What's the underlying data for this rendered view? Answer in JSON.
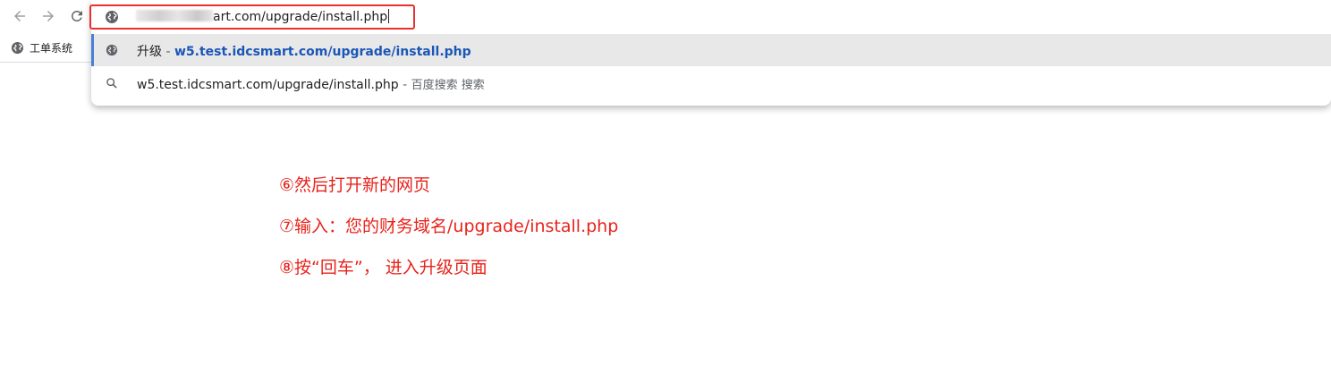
{
  "toolbar": {
    "back_icon": "arrow-left-icon",
    "forward_icon": "arrow-right-icon",
    "reload_icon": "reload-icon"
  },
  "bookmarks": {
    "items": [
      {
        "label": "工单系统",
        "icon": "globe-icon"
      }
    ]
  },
  "address_bar": {
    "value_visible": "art.com/upgrade/install.php",
    "icon": "globe-icon",
    "highlight_color": "#e8312c"
  },
  "suggestions": [
    {
      "icon": "globe-icon",
      "title": "升级",
      "separator": " - ",
      "url": "w5.test.idcsmart.com/upgrade/install.php",
      "selected": true
    },
    {
      "icon": "search-icon",
      "query": "w5.test.idcsmart.com/upgrade/install.php",
      "separator": " - ",
      "engine": "百度搜索 搜索",
      "selected": false
    }
  ],
  "instructions": {
    "color": "#e8231b",
    "lines": [
      "⑥然后打开新的网页",
      "⑦输入：您的财务域名/upgrade/install.php",
      "⑧按“回车”， 进入升级页面"
    ]
  }
}
